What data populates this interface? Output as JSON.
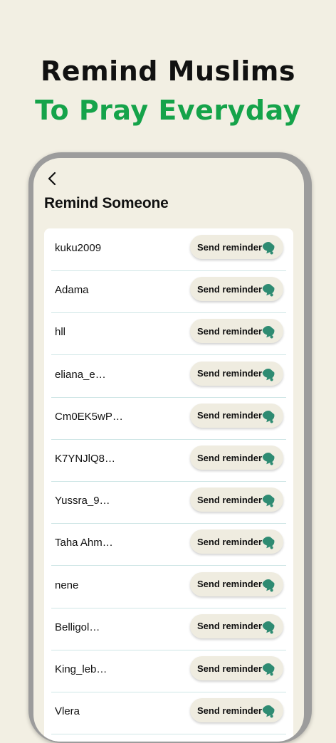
{
  "headline": {
    "line1": "Remind Muslims",
    "line2": "To Pray Everyday"
  },
  "screen": {
    "title": "Remind Someone",
    "back_icon": "chevron-left-icon",
    "button_label": "Send reminder",
    "button_icon": "bell-icon",
    "accent_color": "#2e8b72",
    "users": [
      "kuku2009",
      "Adama",
      "hll",
      "eliana_e…",
      "Cm0EK5wP…",
      "K7YNJlQ8…",
      "Yussra_9…",
      "Taha Ahm…",
      "nene",
      "Belligol…",
      "King_leb…",
      "Vlera"
    ]
  }
}
